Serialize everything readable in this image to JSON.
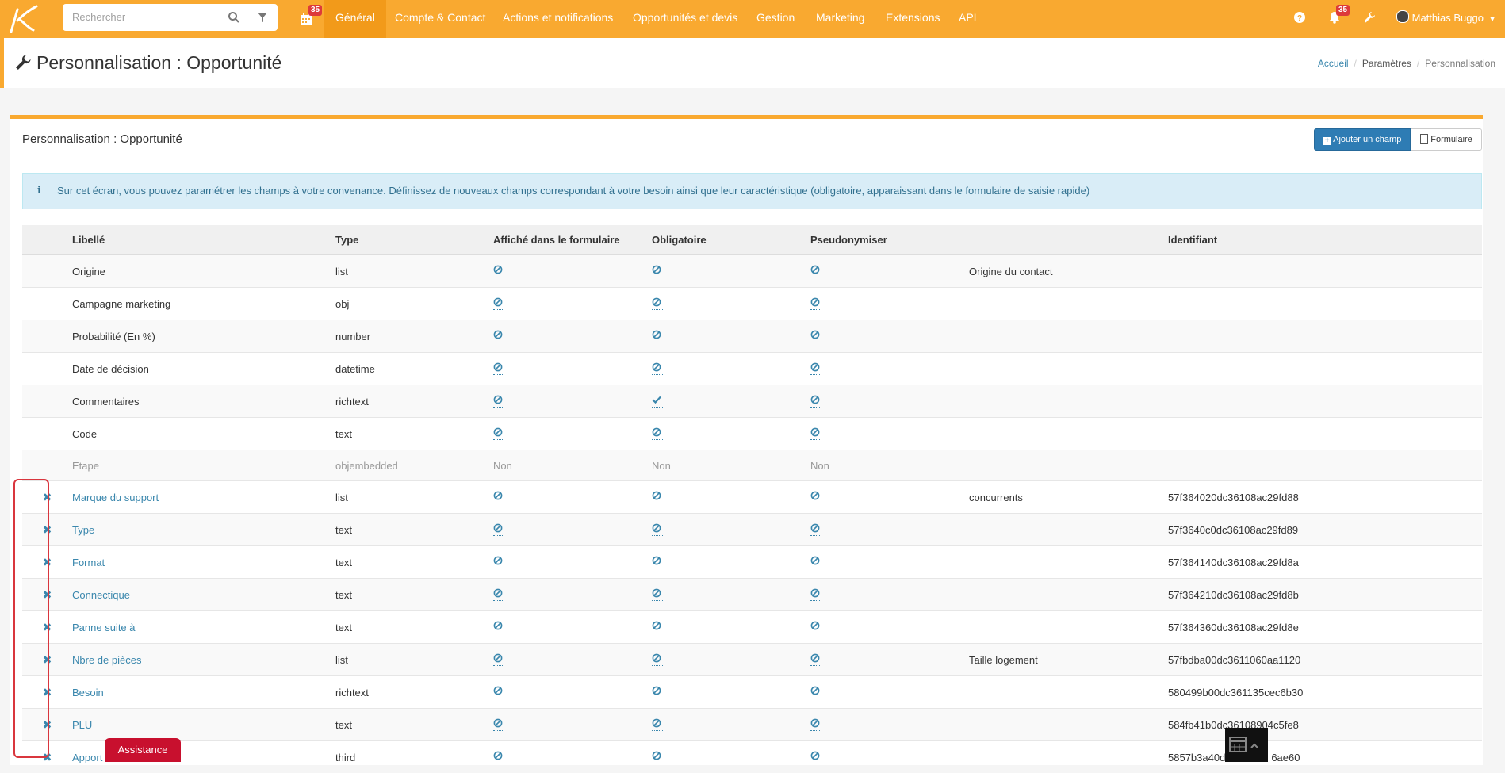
{
  "header": {
    "search_placeholder": "Rechercher",
    "calendar_badge": "35",
    "notifications_badge": "35",
    "nav": [
      "Général",
      "Compte & Contact",
      "Actions et notifications",
      "Opportunités et devis",
      "Gestion",
      "Marketing",
      "Extensions",
      "API"
    ],
    "active_nav": "Général",
    "user_name": "Matthias Buggo",
    "accent_color": "#f9a930"
  },
  "page": {
    "title": "Personnalisation : Opportunité",
    "breadcrumb": [
      "Accueil",
      "Paramètres",
      "Personnalisation"
    ]
  },
  "panel": {
    "title": "Personnalisation : Opportunité",
    "add_button": "Ajouter un champ",
    "form_button": "Formulaire",
    "info_text": "Sur cet écran, vous pouvez paramétrer les champs à votre convenance. Définissez de nouveaux champs correspondant à votre besoin ainsi que leur caractéristique (obligatoire, apparaissant dans le formulaire de saisie rapide)"
  },
  "table": {
    "columns": [
      "Libellé",
      "Type",
      "Affiché dans le formulaire",
      "Obligatoire",
      "Pseudonymiser",
      "",
      "Identifiant"
    ],
    "rows": [
      {
        "label": "Origine",
        "type": "list",
        "form": "off",
        "required": "off",
        "pseudo": "off",
        "extra": "Origine du contact",
        "id": "",
        "deletable": false
      },
      {
        "label": "Campagne marketing",
        "type": "obj",
        "form": "off",
        "required": "off",
        "pseudo": "off",
        "extra": "",
        "id": "",
        "deletable": false
      },
      {
        "label": "Probabilité (En %)",
        "type": "number",
        "form": "off",
        "required": "off",
        "pseudo": "off",
        "extra": "",
        "id": "",
        "deletable": false
      },
      {
        "label": "Date de décision",
        "type": "datetime",
        "form": "off",
        "required": "off",
        "pseudo": "off",
        "extra": "",
        "id": "",
        "deletable": false
      },
      {
        "label": "Commentaires",
        "type": "richtext",
        "form": "off",
        "required": "on",
        "pseudo": "off",
        "extra": "",
        "id": "",
        "deletable": false
      },
      {
        "label": "Code",
        "type": "text",
        "form": "off",
        "required": "off",
        "pseudo": "off",
        "extra": "",
        "id": "",
        "deletable": false
      },
      {
        "label": "Etape",
        "type": "objembedded",
        "form": "Non",
        "required": "Non",
        "pseudo": "Non",
        "extra": "",
        "id": "",
        "deletable": false
      },
      {
        "label": "Marque du support",
        "type": "list",
        "form": "off",
        "required": "off",
        "pseudo": "off",
        "extra": "concurrents",
        "id": "57f364020dc36108ac29fd88",
        "deletable": true
      },
      {
        "label": "Type",
        "type": "text",
        "form": "off",
        "required": "off",
        "pseudo": "off",
        "extra": "",
        "id": "57f3640c0dc36108ac29fd89",
        "deletable": true
      },
      {
        "label": "Format",
        "type": "text",
        "form": "off",
        "required": "off",
        "pseudo": "off",
        "extra": "",
        "id": "57f364140dc36108ac29fd8a",
        "deletable": true
      },
      {
        "label": "Connectique",
        "type": "text",
        "form": "off",
        "required": "off",
        "pseudo": "off",
        "extra": "",
        "id": "57f364210dc36108ac29fd8b",
        "deletable": true
      },
      {
        "label": "Panne suite à",
        "type": "text",
        "form": "off",
        "required": "off",
        "pseudo": "off",
        "extra": "",
        "id": "57f364360dc36108ac29fd8e",
        "deletable": true
      },
      {
        "label": "Nbre de pièces",
        "type": "list",
        "form": "off",
        "required": "off",
        "pseudo": "off",
        "extra": "Taille logement",
        "id": "57fbdba00dc3611060aa1120",
        "deletable": true
      },
      {
        "label": "Besoin",
        "type": "richtext",
        "form": "off",
        "required": "off",
        "pseudo": "off",
        "extra": "",
        "id": "580499b00dc361135cec6b30",
        "deletable": true
      },
      {
        "label": "PLU",
        "type": "text",
        "form": "off",
        "required": "off",
        "pseudo": "off",
        "extra": "",
        "id": "584fb41b0dc36108904c5fe8",
        "deletable": true
      },
      {
        "label": "Apport",
        "type": "third",
        "form": "off",
        "required": "off",
        "pseudo": "off",
        "extra": "",
        "id": "5857b3a40d",
        "id_tail": "6ae60",
        "deletable": true
      }
    ]
  },
  "assistance_label": "Assistance"
}
